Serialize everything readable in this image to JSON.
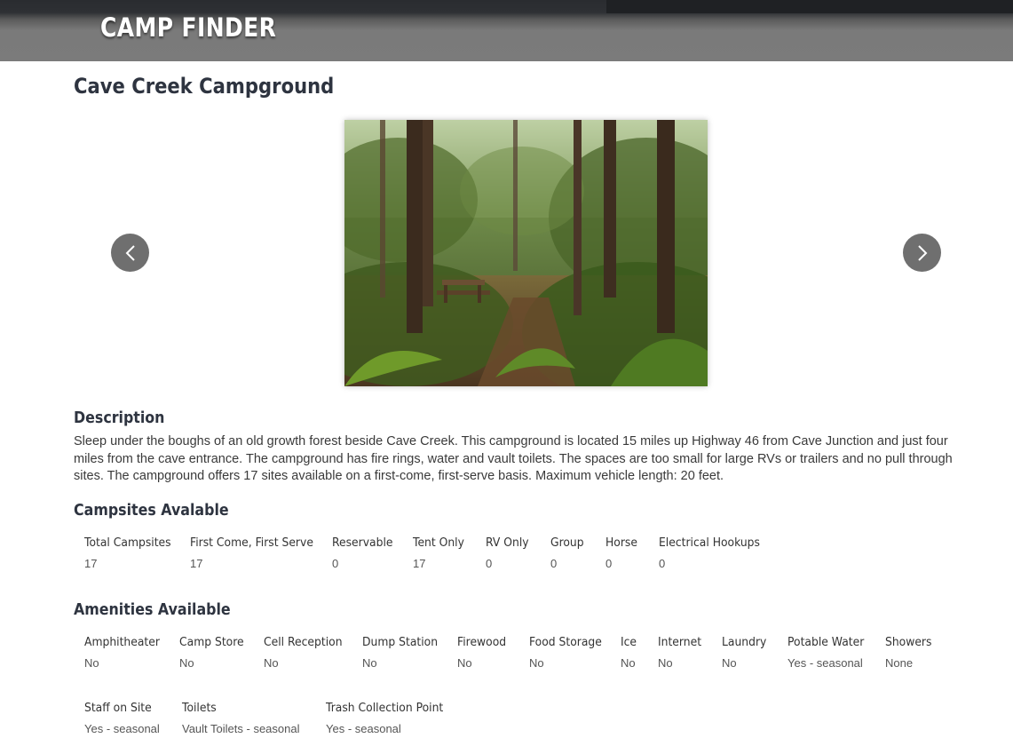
{
  "header": {
    "brand": "CAMP FINDER"
  },
  "page": {
    "title": "Cave Creek Campground"
  },
  "gallery": {
    "prev_icon": "chevron-left-icon",
    "next_icon": "chevron-right-icon"
  },
  "description": {
    "heading": "Description",
    "text": "Sleep under the boughs of an old growth forest beside Cave Creek. This campground is located 15 miles up Highway 46 from Cave Junction and just four miles from the cave entrance. The campground has fire rings, water and vault toilets. The spaces are too small for large RVs or trailers and no pull through sites. The campground offers 17 sites available on a first-come, first-serve basis. Maximum vehicle length: 20 feet."
  },
  "campsites": {
    "heading": "Campsites Avalable",
    "items": [
      {
        "label": "Total Campsites",
        "value": "17"
      },
      {
        "label": "First Come, First Serve",
        "value": "17"
      },
      {
        "label": "Reservable",
        "value": "0"
      },
      {
        "label": "Tent Only",
        "value": "17"
      },
      {
        "label": "RV Only",
        "value": "0"
      },
      {
        "label": "Group",
        "value": "0"
      },
      {
        "label": "Horse",
        "value": "0"
      },
      {
        "label": "Electrical Hookups",
        "value": "0"
      }
    ]
  },
  "amenities": {
    "heading": "Amenities Available",
    "items": [
      {
        "label": "Amphitheater",
        "value": "No"
      },
      {
        "label": "Camp Store",
        "value": "No"
      },
      {
        "label": "Cell Reception",
        "value": "No"
      },
      {
        "label": "Dump Station",
        "value": "No"
      },
      {
        "label": "Firewood",
        "value": "No"
      },
      {
        "label": "Food Storage",
        "value": "No"
      },
      {
        "label": "Ice",
        "value": "No"
      },
      {
        "label": "Internet",
        "value": "No"
      },
      {
        "label": "Laundry",
        "value": "No"
      },
      {
        "label": "Potable Water",
        "value": "Yes - seasonal"
      },
      {
        "label": "Showers",
        "value": "None"
      },
      {
        "label": "Staff on Site",
        "value": "Yes - seasonal"
      },
      {
        "label": "Toilets",
        "value": "Vault Toilets - seasonal"
      },
      {
        "label": "Trash Collection Point",
        "value": "Yes - seasonal"
      }
    ]
  }
}
